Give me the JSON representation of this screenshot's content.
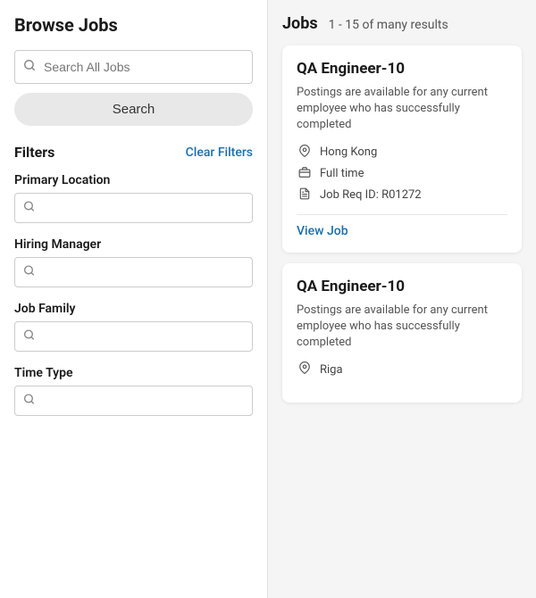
{
  "page": {
    "title": "Browse Jobs"
  },
  "search": {
    "placeholder": "Search All Jobs",
    "button_label": "Search"
  },
  "filters": {
    "title": "Filters",
    "clear_label": "Clear Filters",
    "groups": [
      {
        "id": "primary-location",
        "label": "Primary Location",
        "placeholder": ""
      },
      {
        "id": "hiring-manager",
        "label": "Hiring Manager",
        "placeholder": ""
      },
      {
        "id": "job-family",
        "label": "Job Family",
        "placeholder": ""
      },
      {
        "id": "time-type",
        "label": "Time Type",
        "placeholder": ""
      }
    ]
  },
  "jobs_panel": {
    "title": "Jobs",
    "count_text": "1 - 15 of many results",
    "jobs": [
      {
        "id": "job-1",
        "title": "QA Engineer-10",
        "description": "Postings are available for any current employee who has successfully completed",
        "location": "Hong Kong",
        "type": "Full time",
        "req_id": "Job Req ID: R01272",
        "view_label": "View Job"
      },
      {
        "id": "job-2",
        "title": "QA Engineer-10",
        "description": "Postings are available for any current employee who has successfully completed",
        "location": "Riga",
        "type": null,
        "req_id": null,
        "view_label": null
      }
    ]
  },
  "icons": {
    "search": "🔍",
    "location": "📍",
    "briefcase": "💼",
    "document": "📋"
  }
}
